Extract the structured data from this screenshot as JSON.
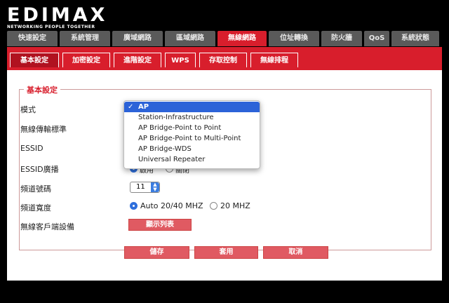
{
  "logo": {
    "text": "EDIMAX",
    "tagline": "NETWORKING PEOPLE TOGETHER"
  },
  "main_tabs": [
    "快速設定",
    "系統管理",
    "廣域網路",
    "區域網路",
    "無線網路",
    "位址轉換",
    "防火牆",
    "QoS",
    "系統狀態"
  ],
  "active_main_tab": "無線網路",
  "sub_tabs": [
    "基本設定",
    "加密設定",
    "進階設定",
    "WPS",
    "存取控制",
    "無線排程"
  ],
  "active_sub_tab": "基本設定",
  "section": {
    "legend": "基本設定"
  },
  "form": {
    "mode_label": "模式",
    "standard_label": "無線傳輸標準",
    "essid_label": "ESSID",
    "essid_broadcast_label": "ESSID廣播",
    "essid_broadcast_options": [
      "啟用",
      "關閉"
    ],
    "channel_label": "頻道號碼",
    "channel_value": "11",
    "bandwidth_label": "頻道寬度",
    "bandwidth_options": [
      "Auto 20/40 MHZ",
      "20 MHZ"
    ],
    "bandwidth_selected": "Auto 20/40 MHZ",
    "clients_label": "無線客戶端設備",
    "show_list_button": "顯示列表"
  },
  "mode_dropdown": {
    "selected": "AP",
    "options": [
      "AP",
      "Station-Infrastructure",
      "AP Bridge-Point to Point",
      "AP Bridge-Point to Multi-Point",
      "AP Bridge-WDS",
      "Universal Repeater"
    ]
  },
  "buttons": {
    "save": "儲存",
    "apply": "套用",
    "cancel": "取消"
  },
  "colors": {
    "accent": "#d81e2c",
    "button": "#e05a62",
    "selection": "#2c63d8"
  }
}
